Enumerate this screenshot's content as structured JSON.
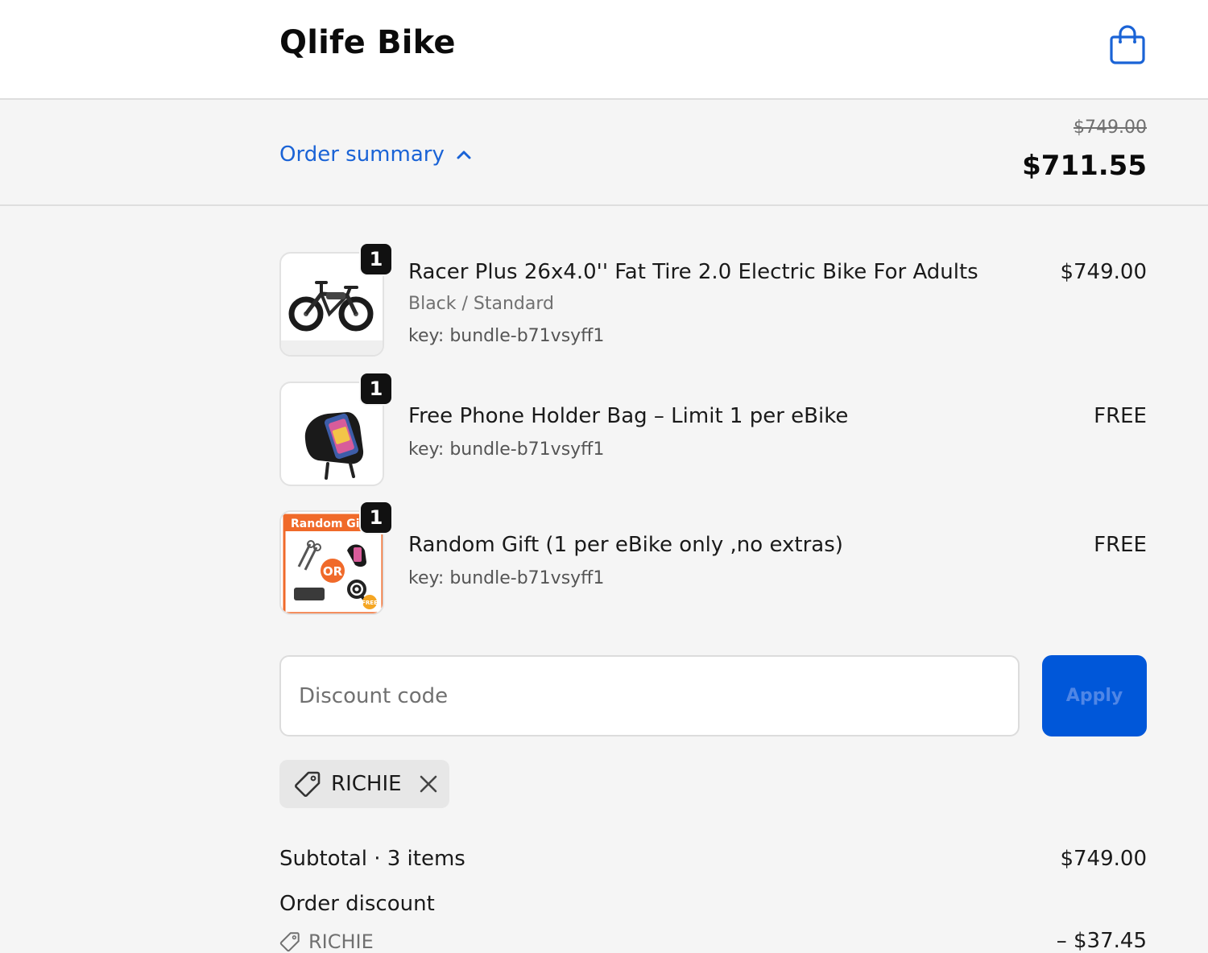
{
  "header": {
    "brand": "Qlife Bike",
    "cart_icon": "shopping-bag-icon"
  },
  "summary_bar": {
    "toggle_label": "Order summary",
    "toggle_icon": "chevron-up-icon",
    "original_total": "$749.00",
    "total": "$711.55"
  },
  "line_items": [
    {
      "title": "Racer Plus 26x4.0'' Fat Tire 2.0 Electric Bike For Adults",
      "variant": "Black / Standard",
      "key": "key: bundle-b71vsyff1",
      "price": "$749.00",
      "quantity": "1",
      "image": "electric-bike-image"
    },
    {
      "title": "Free Phone Holder Bag – Limit 1 per eBike",
      "variant": "",
      "key": "key: bundle-b71vsyff1",
      "price": "FREE",
      "quantity": "1",
      "image": "phone-holder-bag-image"
    },
    {
      "title": "Random Gift (1 per eBike only ,no extras)",
      "variant": "",
      "key": "key: bundle-b71vsyff1",
      "price": "FREE",
      "quantity": "1",
      "image": "random-gift-image",
      "image_text": {
        "banner": "Random Gi",
        "or": "OR",
        "free": "FREE"
      }
    }
  ],
  "discount": {
    "placeholder": "Discount code",
    "value": "",
    "apply_label": "Apply",
    "applied_code": "RICHIE"
  },
  "totals": {
    "subtotal_label": "Subtotal · 3 items",
    "subtotal_value": "$749.00",
    "order_discount_label": "Order discount",
    "order_discount_code": "RICHIE",
    "order_discount_value": "– $37.45"
  },
  "colors": {
    "accent": "#1a63d6",
    "apply_button": "#0057d9",
    "background": "#f5f5f5"
  }
}
